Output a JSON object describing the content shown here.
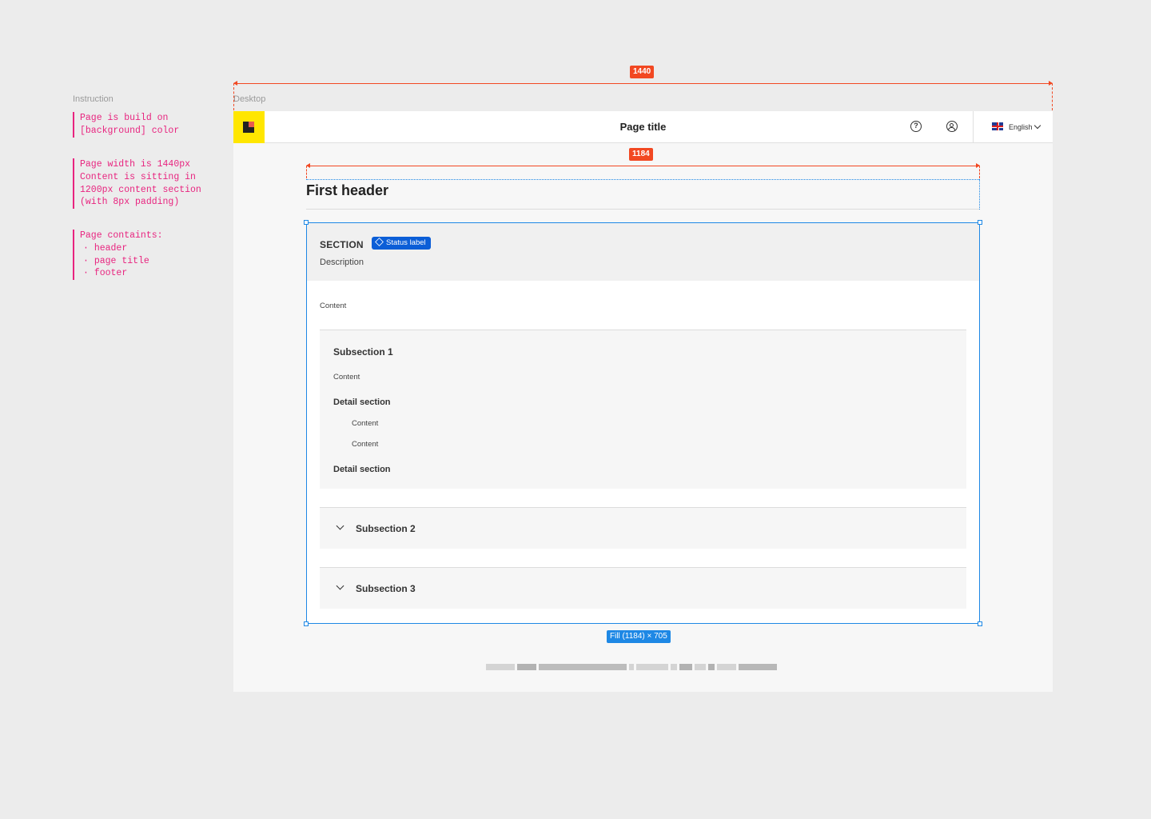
{
  "instruction": {
    "title": "Instruction",
    "note1": "Page is build on\n[background] color",
    "note2": "Page width is 1440px\nContent is sitting in\n1200px content section\n(with 8px padding)",
    "note3_title": "Page containts:",
    "note3_items": [
      "header",
      "page title",
      "footer"
    ]
  },
  "frame": {
    "label": "Desktop",
    "width_badge": "1440",
    "content_badge": "1184",
    "fill_badge": "Fill (1184) × 705"
  },
  "header": {
    "logo_icon": "brand-logo-icon",
    "page_title": "Page title",
    "help_icon_glyph": "?",
    "language": "English"
  },
  "main": {
    "first_header": "First header",
    "section": {
      "title": "SECTION",
      "status_label": "Status label",
      "description": "Description",
      "content": "Content"
    },
    "subsection1": {
      "title": "Subsection 1",
      "content": "Content",
      "detail1": "Detail section",
      "detail_items": [
        "Content",
        "Content"
      ],
      "detail2": "Detail section"
    },
    "subsection2": {
      "title": "Subsection 2"
    },
    "subsection3": {
      "title": "Subsection 3"
    }
  },
  "colors": {
    "accent": "#f24822",
    "selection": "#1e88e5",
    "brand_yellow": "#ffe600",
    "status_blue": "#0b5ed7"
  }
}
